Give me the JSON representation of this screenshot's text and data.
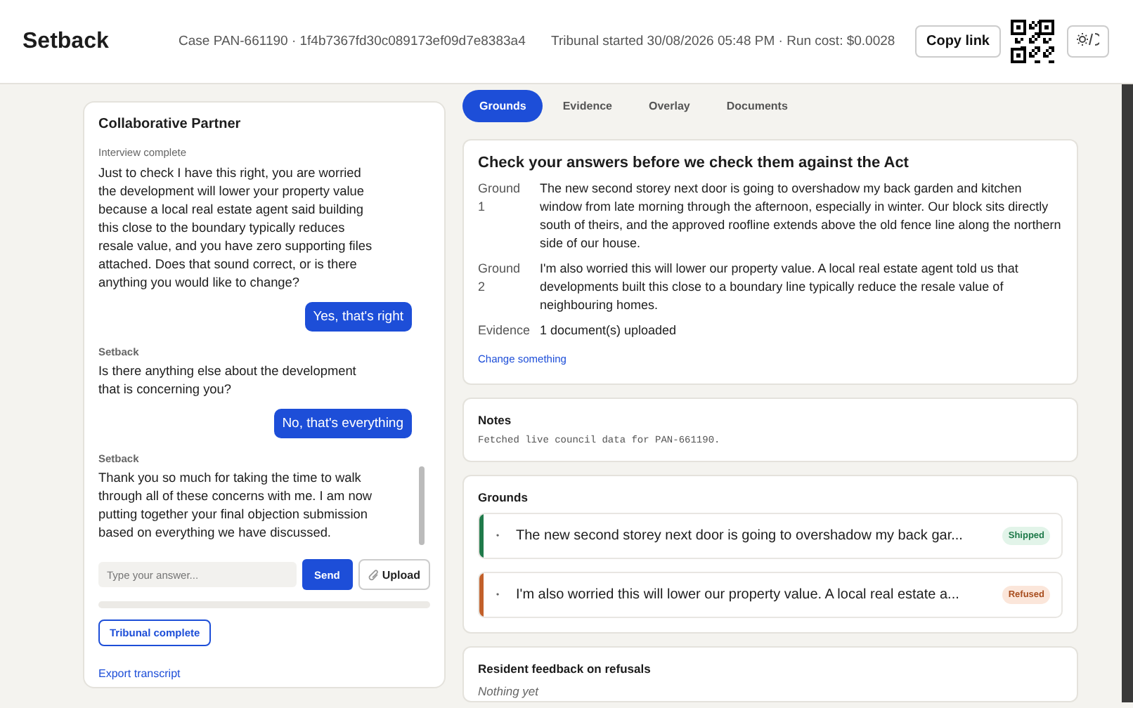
{
  "header": {
    "title": "Setback",
    "case": "Case PAN-661190 · 1f4b7367fd30c089173ef09d7e8383a4",
    "run_info": "Tribunal started 30/08/2026 05:48 PM · Run cost: $0.0028",
    "copy_button": "Copy link"
  },
  "chat": {
    "title": "Collaborative Partner",
    "status": "Interview complete",
    "messages": [
      {
        "kind": "bot",
        "text": "Just to check I have this right, you are worried the development will lower your property value because a local real estate agent said building this close to the boundary typically reduces resale value, and you have zero supporting files attached. Does that sound correct, or is there anything you would like to change?"
      },
      {
        "kind": "user",
        "text": "Yes, that's right"
      },
      {
        "kind": "bot",
        "author": "Setback",
        "text": "Is there anything else about the development that is concerning you?"
      },
      {
        "kind": "user",
        "text": "No, that's everything"
      },
      {
        "kind": "bot",
        "author": "Setback",
        "text": "Thank you so much for taking the time to walk through all of these concerns with me. I am now putting together your final objection submission based on everything we have discussed."
      }
    ],
    "input": {
      "placeholder": "Type your answer..."
    },
    "send_button": "Send",
    "upload_button": "Upload",
    "complete_button": "Tribunal complete",
    "export_link": "Export transcript"
  },
  "tabs": [
    {
      "label": "Grounds",
      "selected": true
    },
    {
      "label": "Evidence",
      "selected": false
    },
    {
      "label": "Overlay",
      "selected": false
    },
    {
      "label": "Documents",
      "selected": false
    }
  ],
  "review": {
    "title": "Check your answers before we check them against the Act",
    "rows": [
      {
        "label": "Ground 1",
        "value": "The new second storey next door is going to overshadow my back garden and kitchen window from late morning through the afternoon, especially in winter. Our block sits directly south of theirs, and the approved roofline extends above the old fence line along the northern side of our house."
      },
      {
        "label": "Ground 2",
        "value": "I'm also worried this will lower our property value. A local real estate agent told us that developments built this close to a boundary line typically reduce the resale value of neighbouring homes."
      },
      {
        "label": "Evidence",
        "value": "1 document(s) uploaded"
      }
    ],
    "link": "Change something"
  },
  "notes": {
    "title": "Notes",
    "text": "Fetched live council data for PAN-661190."
  },
  "grounds": {
    "title": "Grounds",
    "items": [
      {
        "bullet": "•",
        "text": "The new second storey next door is going to overshadow my back gar...",
        "status": "Shipped",
        "kind": "shipped",
        "color": "#1f7a4a"
      },
      {
        "bullet": "•",
        "text": "I'm also worried this will lower our property value. A local real estate a...",
        "status": "Refused",
        "kind": "refused",
        "color": "#c2602a"
      }
    ]
  },
  "feedback": {
    "title": "Resident feedback on refusals",
    "text": "Nothing yet"
  }
}
